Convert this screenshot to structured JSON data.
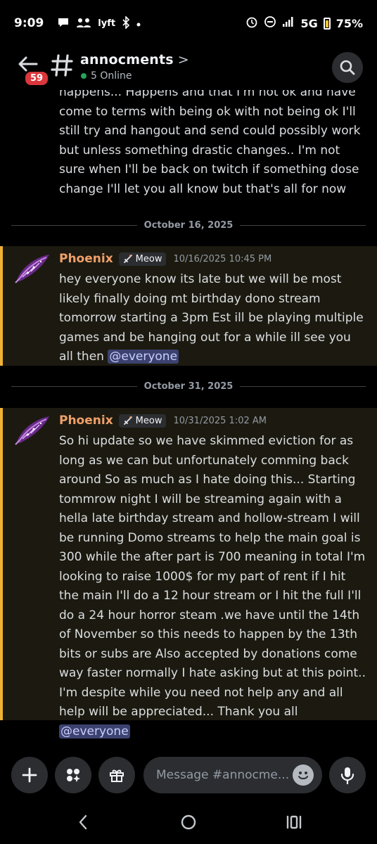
{
  "status_bar": {
    "time": "9:09",
    "lyft": "lyft",
    "network": "5G",
    "battery": "75%"
  },
  "header": {
    "channel_name": "annocments",
    "online_count": "5 Online",
    "unread_badge": "59"
  },
  "previous_message": {
    "text": "happens... Happens  and that I'm not ok and have come to terms with being ok with not being ok I'll still try and hangout and send could possibly work but unless something drastic changes.. I'm not sure when I'll be back on twitch if something dose change I'll let you all know but that's all for now"
  },
  "dividers": [
    {
      "label": "October 16, 2025"
    },
    {
      "label": "October 31, 2025"
    }
  ],
  "messages": [
    {
      "author": "Phoenix",
      "role": "Meow",
      "timestamp": "10/16/2025 10:45 PM",
      "text": "hey everyone know its late but  we will be most likely finally doing mt birthday dono stream tomorrow starting a 3pm Est ill be playing multiple games  and be hanging out for a while ill see  you all then",
      "mention": "@everyone"
    },
    {
      "author": "Phoenix",
      "role": "Meow",
      "timestamp": "10/31/2025 1:02 AM",
      "text": "So hi update so we have skimmed eviction for as long as we can but  unfortunately comming back around So as much as I hate doing this... Starting tommrow night I will be streaming again with a hella late birthday stream and hollow-stream I will be running Domo streams to help the main goal is 300 while the after part is 700 meaning in total I'm looking to raise 1000$ for my part of rent if I hit the main I'll do a 12 hour stream or I hit the full I'll do a 24 hour horror steam .we have until the 14th of November so this needs to happen by the 13th bits or subs are Also accepted by donations come way faster normally I hate asking but at this point.. I'm despite while you need not help any and all help will be appreciated... Thank you all",
      "mention": "@everyone"
    }
  ],
  "composer": {
    "placeholder": "Message #annocme..."
  },
  "colors": {
    "accent_bar": "#f0b232",
    "author": "#f0a06a",
    "online": "#23a55a",
    "badge": "#da373c"
  }
}
